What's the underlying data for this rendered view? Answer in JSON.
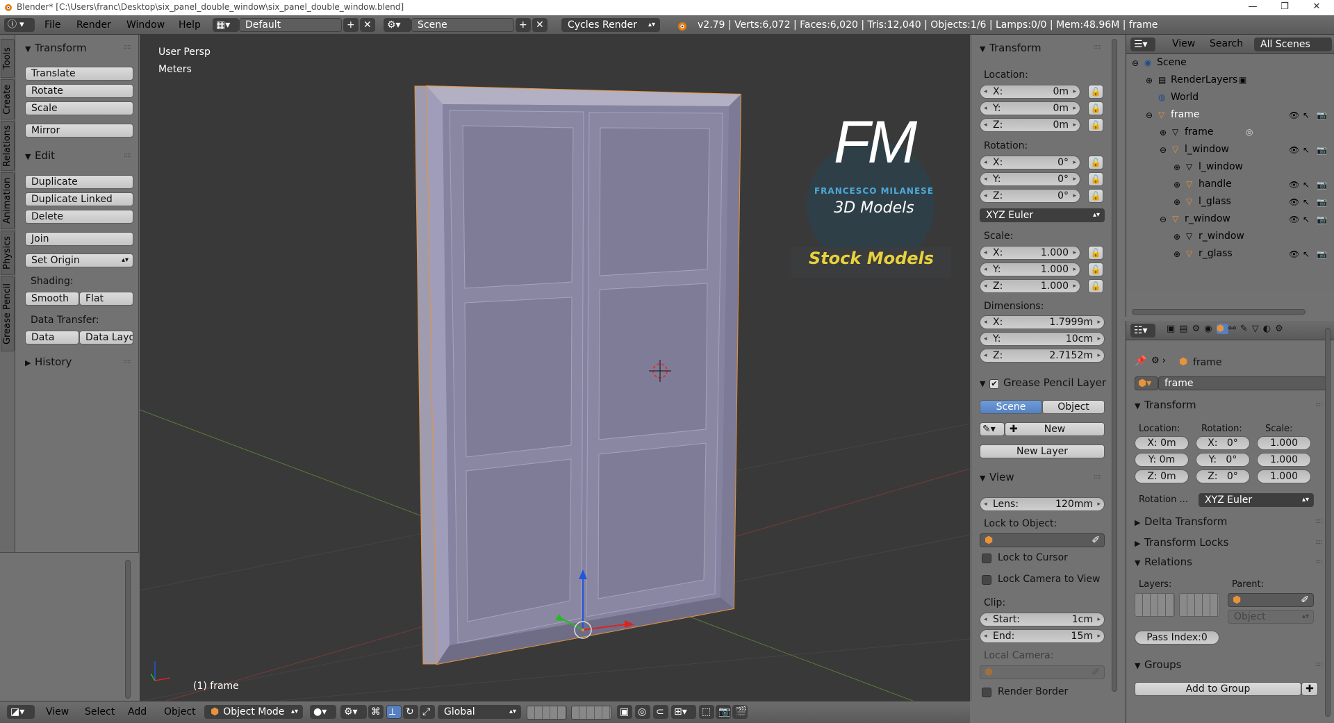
{
  "titlebar": {
    "title": "Blender* [C:\\Users\\franc\\Desktop\\six_panel_double_window\\six_panel_double_window.blend]",
    "minimize": "—",
    "restore": "❐",
    "close": "✕"
  },
  "infobar": {
    "menus": [
      "File",
      "Render",
      "Window",
      "Help"
    ],
    "layout": "Default",
    "scene": "Scene",
    "engine": "Cycles Render",
    "stats": "v2.79 | Verts:6,072 | Faces:6,020 | Tris:12,040 | Objects:1/6 | Lamps:0/0 | Mem:48.96M | frame"
  },
  "tabs": [
    "Tools",
    "Create",
    "Relations",
    "Animation",
    "Physics",
    "Grease Pencil"
  ],
  "toolshelf": {
    "transform": {
      "title": "Transform",
      "buttons": [
        "Translate",
        "Rotate",
        "Scale",
        "Mirror"
      ]
    },
    "edit": {
      "title": "Edit",
      "buttons": [
        "Duplicate",
        "Duplicate Linked",
        "Delete",
        "Join",
        "Set Origin"
      ]
    },
    "shading_label": "Shading:",
    "shading": [
      "Smooth",
      "Flat"
    ],
    "transfer_label": "Data Transfer:",
    "transfer": [
      "Data",
      "Data Layo"
    ],
    "history": "History"
  },
  "viewport": {
    "persp": "User Persp",
    "units": "Meters",
    "object_label": "(1) frame",
    "logo_letters": "FM",
    "logo_name": "FRANCESCO MILANESE",
    "logo_sub": "3D Models",
    "logo_banner": "Stock Models"
  },
  "npanel": {
    "transform_title": "Transform",
    "location_label": "Location:",
    "location": {
      "x": "0m",
      "y": "0m",
      "z": "0m"
    },
    "rotation_label": "Rotation:",
    "rotation": {
      "x": "0°",
      "y": "0°",
      "z": "0°"
    },
    "rotation_mode": "XYZ Euler",
    "scale_label": "Scale:",
    "scale": {
      "x": "1.000",
      "y": "1.000",
      "z": "1.000"
    },
    "dimensions_label": "Dimensions:",
    "dimensions": {
      "x": "1.7999m",
      "y": "10cm",
      "z": "2.7152m"
    },
    "gp_title": "Grease Pencil Layer",
    "gp_tabs": [
      "Scene",
      "Object"
    ],
    "gp_new": "New",
    "gp_new_layer": "New Layer",
    "view_title": "View",
    "lens_label": "Lens:",
    "lens": "120mm",
    "lock_obj_label": "Lock to Object:",
    "lock_cursor": "Lock to Cursor",
    "lock_camera": "Lock Camera to View",
    "clip_label": "Clip:",
    "clip_start_label": "Start:",
    "clip_start": "1cm",
    "clip_end_label": "End:",
    "clip_end": "15m",
    "local_camera": "Local Camera:",
    "render_border": "Render Border",
    "axis": {
      "x": "X:",
      "y": "Y:",
      "z": "Z:"
    }
  },
  "outliner": {
    "menus": [
      "View",
      "Search"
    ],
    "filter": "All Scenes",
    "items": [
      {
        "label": "Scene",
        "depth": 0
      },
      {
        "label": "RenderLayers",
        "depth": 1
      },
      {
        "label": "World",
        "depth": 1
      },
      {
        "label": "frame",
        "depth": 1
      },
      {
        "label": "frame",
        "depth": 2
      },
      {
        "label": "l_window",
        "depth": 2
      },
      {
        "label": "l_window",
        "depth": 3
      },
      {
        "label": "handle",
        "depth": 3
      },
      {
        "label": "l_glass",
        "depth": 3
      },
      {
        "label": "r_window",
        "depth": 2
      },
      {
        "label": "r_window",
        "depth": 3
      },
      {
        "label": "r_glass",
        "depth": 3
      }
    ]
  },
  "props": {
    "breadcrumb": "frame",
    "object_name": "frame",
    "transform_title": "Transform",
    "location_label": "Location:",
    "rotation_label": "Rotation:",
    "scale_label": "Scale:",
    "loc": [
      "X: 0m",
      "Y: 0m",
      "Z: 0m"
    ],
    "rot": [
      "X:   0°",
      "Y:   0°",
      "Z:   0°"
    ],
    "scl": [
      "1.000",
      "1.000",
      "1.000"
    ],
    "rotation_mode_label": "Rotation ...",
    "rotation_mode": "XYZ Euler",
    "delta": "Delta Transform",
    "locks": "Transform Locks",
    "relations": "Relations",
    "layers_label": "Layers:",
    "parent_label": "Parent:",
    "parent_type": "Object",
    "pass_index": "Pass Index:0",
    "groups": "Groups",
    "add_group": "Add to Group"
  },
  "bottombar": {
    "menus": [
      "View",
      "Select",
      "Add",
      "Object"
    ],
    "mode": "Object Mode",
    "orientation": "Global"
  }
}
